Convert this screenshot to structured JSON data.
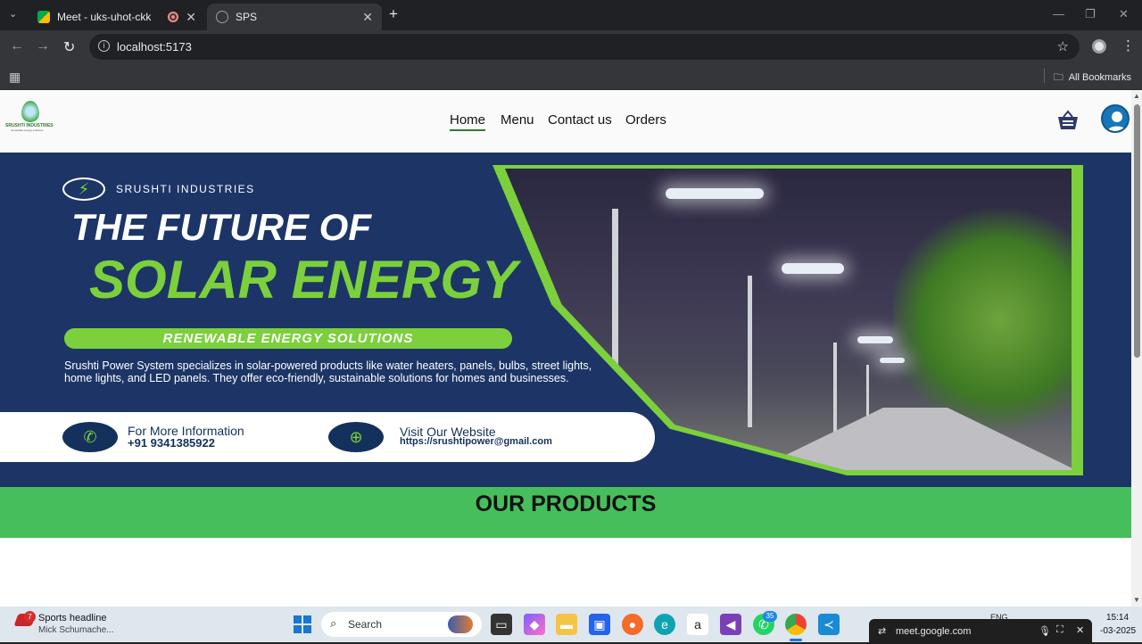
{
  "browser": {
    "tabs": [
      {
        "title": "Meet - uks-uhot-ckk",
        "active": false
      },
      {
        "title": "SPS",
        "active": true
      }
    ],
    "url": "localhost:5173",
    "bookmarks_label": "All Bookmarks"
  },
  "site": {
    "logo_text": "SRUSHTI INDUSTRIES",
    "logo_tagline": "renewable energy solutions",
    "nav": [
      "Home",
      "Menu",
      "Contact us",
      "Orders"
    ]
  },
  "banner": {
    "brand": "SRUSHTI INDUSTRIES",
    "headline_1": "THE FUTURE OF",
    "headline_2": "SOLAR ENERGY",
    "pill": "RENEWABLE ENERGY SOLUTIONS",
    "description": "Srushti Power System specializes in solar-powered products like water heaters, panels, bulbs, street lights, home lights, and LED panels. They offer eco-friendly, sustainable solutions for homes and businesses.",
    "contact_title": "For More Information",
    "contact_phone": "+91 9341385922",
    "website_title": "Visit Our Website",
    "website_value": "https://srushtipower@gmail.com"
  },
  "products_heading": "OUR PRODUCTS",
  "taskbar": {
    "news_title": "Sports headline",
    "news_sub": "Mick Schumache...",
    "news_badge": "7",
    "search_placeholder": "Search",
    "whatsapp_badge": "35",
    "meet_label": "meet.google.com",
    "lang": "ENG",
    "time": "15:14",
    "date": "-03-2025"
  },
  "colors": {
    "accent_green": "#7cd03b",
    "banner_blue": "#1c3566",
    "products_green": "#47be5c"
  }
}
